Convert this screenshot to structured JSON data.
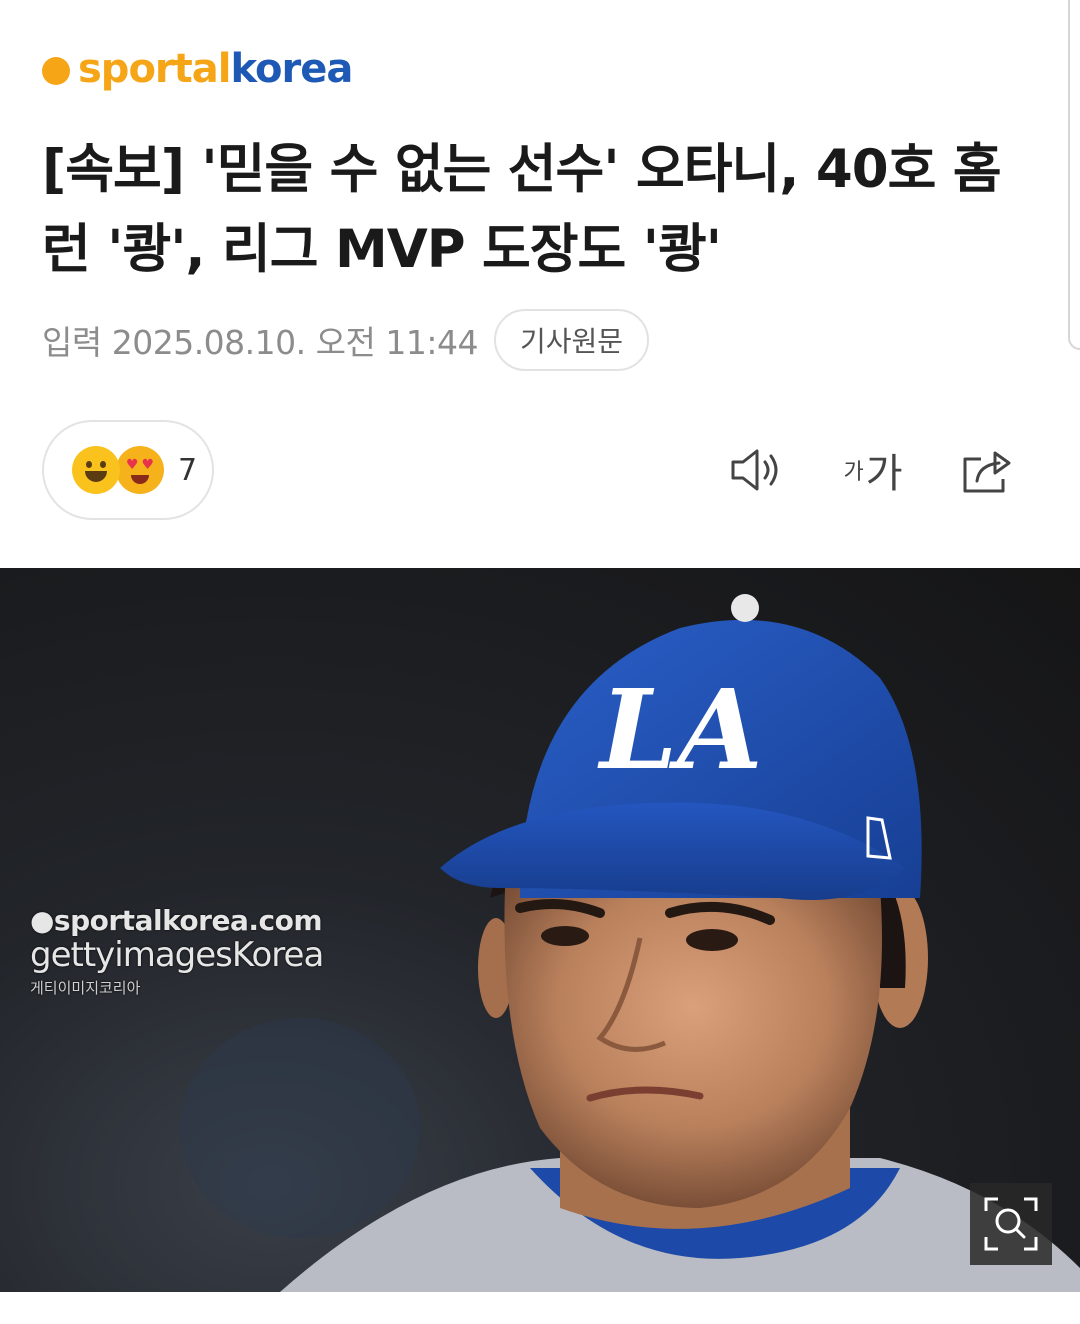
{
  "header": {
    "logo_part_a": "sportal",
    "logo_part_b": "korea"
  },
  "article": {
    "headline": "[속보] '믿을 수 없는 선수' 오타니, 40호 홈런 '쾅', 리그 MVP 도장도 '쾅'",
    "date": "입력 2025.08.10. 오전 11:44",
    "source_button": "기사원문"
  },
  "reactions": {
    "count": "7",
    "emojis": [
      "smile-emoji",
      "heart-eyes-emoji"
    ]
  },
  "toolbar": {
    "font_small": "가",
    "font_large": "가",
    "icons": [
      "speaker-icon",
      "font-size-icon",
      "share-icon"
    ]
  },
  "photo": {
    "watermark_line1": "●sportalkorea.com",
    "watermark_line2": "gettyimagesKorea",
    "watermark_line3": "게티이미지코리아",
    "zoom_icon": "zoom-icon"
  },
  "colors": {
    "brand_orange": "#f5a516",
    "brand_blue": "#1e5ab5",
    "cap_blue": "#1f4fae"
  }
}
